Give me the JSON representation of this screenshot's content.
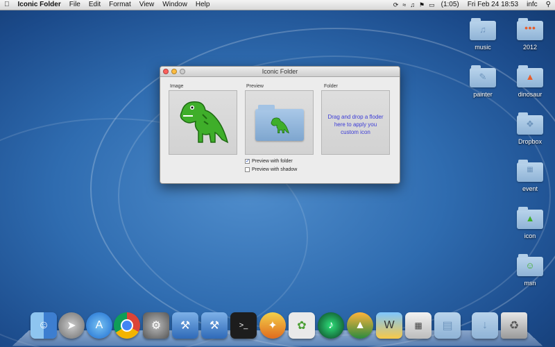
{
  "menubar": {
    "apple_symbol": "",
    "app_name": "Iconic Folder",
    "menus": [
      "File",
      "Edit",
      "Format",
      "View",
      "Window",
      "Help"
    ],
    "status": {
      "battery_time": "(1:05)",
      "datetime": "Fri Feb 24  18:53",
      "user": "infc",
      "search_icon": "search-icon"
    }
  },
  "window": {
    "title": "Iconic Folder",
    "image_label": "Image",
    "preview_label": "Preview",
    "folder_label": "Folder",
    "drop_text": "Drag and drop a floder here to apply you custom icon",
    "preview_with_folder": {
      "label": "Preview with folder",
      "checked": true
    },
    "preview_with_shadow": {
      "label": "Preview with shadow",
      "checked": false
    }
  },
  "desktop_icons": [
    {
      "label": "music"
    },
    {
      "label": "2012"
    },
    {
      "label": "painter"
    },
    {
      "label": "dinosaur"
    },
    {
      "label": "Dropbox"
    },
    {
      "label": "event"
    },
    {
      "label": "icon"
    },
    {
      "label": "msn"
    }
  ],
  "dock": {
    "items": [
      "finder",
      "launchpad",
      "app-store",
      "chrome",
      "system-preferences",
      "xcode",
      "instruments",
      "terminal",
      "raygun",
      "evernote",
      "sound-app",
      "wings",
      "dictionary",
      "calculator",
      "applications-folder",
      "downloads-folder",
      "trash"
    ]
  },
  "colors": {
    "desktop_blue": "#2f6cb0",
    "dino_green": "#3fae2a",
    "drop_text": "#3b3bd6"
  }
}
